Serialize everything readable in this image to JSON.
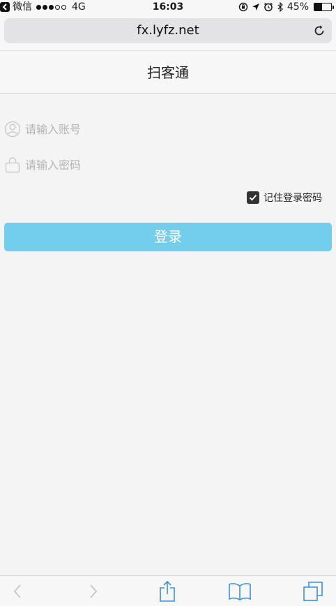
{
  "status_bar": {
    "back_app": "微信",
    "network": "4G",
    "time": "16:03",
    "battery_percent": "45%",
    "battery_level": 0.45,
    "signal_strength": 3,
    "signal_max": 5
  },
  "browser": {
    "url": "fx.lyfz.net",
    "reload_icon": "reload-icon"
  },
  "page": {
    "title": "扫客通"
  },
  "login_form": {
    "account_placeholder": "请输入账号",
    "account_value": "",
    "password_placeholder": "请输入密码",
    "password_value": "",
    "remember_label": "记住登录密码",
    "remember_checked": true,
    "submit_label": "登录",
    "submit_color": "#73cdec"
  },
  "toolbar": {
    "items": [
      "back-icon",
      "forward-icon",
      "share-icon",
      "bookmarks-icon",
      "tabs-icon"
    ],
    "accent_color": "#3d8fd9"
  }
}
